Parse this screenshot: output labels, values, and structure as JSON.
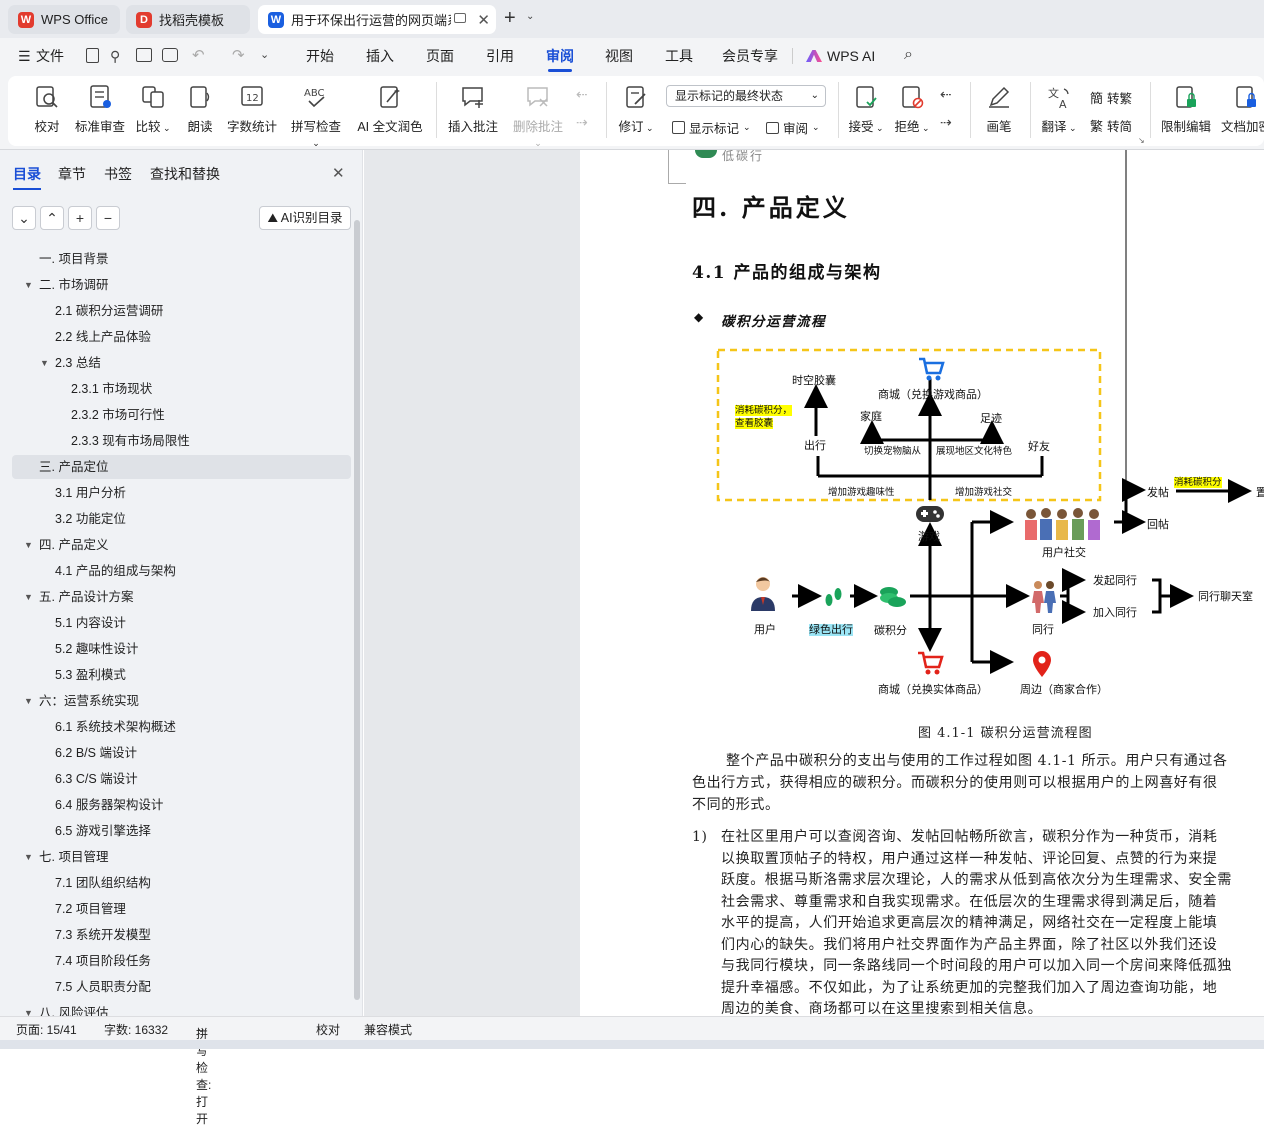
{
  "tabs": [
    {
      "label": "WPS Office",
      "icon_color": "#e23b2e"
    },
    {
      "label": "找稻壳模板",
      "icon_color": "#e23b2e"
    },
    {
      "label": "用于环保出行运营的网页端系",
      "icon_color": "#1a5fe0"
    }
  ],
  "menu": {
    "file": "文件",
    "items": [
      "开始",
      "插入",
      "页面",
      "引用",
      "审阅",
      "视图",
      "工具",
      "会员专享"
    ],
    "wps_ai": "WPS AI",
    "selected": "审阅"
  },
  "ribbon": {
    "buttons": [
      "校对",
      "标准审查",
      "比较",
      "朗读",
      "字数统计",
      "拼写检查",
      "AI 全文润色",
      "插入批注",
      "删除批注",
      "修订",
      "画笔",
      "限制编辑",
      "文档加密"
    ],
    "display_state": "显示标记的最终状态",
    "show_markup": "显示标记",
    "review": "审阅",
    "accept": "接受",
    "reject": "拒绝",
    "translate": "翻译",
    "to_traditional": "转繁",
    "to_simplified": "转简"
  },
  "sidebar": {
    "tabs": [
      "目录",
      "章节",
      "书签",
      "查找和替换"
    ],
    "ai_button": "AI识别目录",
    "toc": [
      "一. 项目背景",
      "二. 市场调研",
      "2.1 碳积分运营调研",
      "2.2 线上产品体验",
      "2.3 总结",
      "2.3.1 市场现状",
      "2.3.2 市场可行性",
      "2.3.3 现有市场局限性",
      "三. 产品定位",
      "3.1 用户分析",
      "3.2 功能定位",
      "四. 产品定义",
      "4.1 产品的组成与架构",
      "五. 产品设计方案",
      "5.1 内容设计",
      "5.2 趣味性设计",
      "5.3 盈利模式",
      "六：运营系统实现",
      "6.1 系统技术架构概述",
      "6.2 B/S 端设计",
      "6.3 C/S 端设计",
      "6.4 服务器架构设计",
      "6.5 游戏引擎选择",
      "七. 项目管理",
      "7.1 团队组织结构",
      "7.2 项目管理",
      "7.3 系统开发模型",
      "7.4 项目阶段任务",
      "7.5 人员职责分配",
      "八. 风险评估"
    ]
  },
  "document": {
    "header_text": "低碳行",
    "chapter_title": "四. 产品定义",
    "section_title": "4.1 产品的组成与架构",
    "bullet_title": "碳积分运营流程",
    "figure_caption": "图 4.1-1 碳积分运营流程图",
    "flow_labels": {
      "time_capsule": "时空胶囊",
      "mall_game": "商城（兑换游戏商品）",
      "consume_view": "消耗碳积分，\n查看胶囊",
      "family": "家庭",
      "footprint": "足迹",
      "travel": "出行",
      "friend": "好友",
      "switch_pet": "切换宠物脑从",
      "show_culture": "展现地区文化特色",
      "fun": "增加游戏趣味性",
      "social": "增加游戏社交",
      "game": "游戏",
      "user_social": "用户社交",
      "post": "发帖",
      "consume": "消耗碳积分",
      "pin": "置顶",
      "reply": "回帖",
      "user": "用户",
      "green_travel": "绿色出行",
      "carbon": "碳积分",
      "together": "同行",
      "start_together": "发起同行",
      "join_together": "加入同行",
      "chat": "同行聊天室",
      "mall_real": "商城（兑换实体商品）",
      "nearby": "周边（商家合作）"
    },
    "para1": [
      "整个产品中碳积分的支出与使用的工作过程如图 4.1-1 所示。用户只有通过各",
      "色出行方式，获得相应的碳积分。而碳积分的使用则可以根据用户的上网喜好有很",
      "不同的形式。"
    ],
    "list_num": "1)",
    "para2": [
      "在社区里用户可以查阅咨询、发帖回帖畅所欲言，碳积分作为一种货币，消耗",
      "以换取置顶帖子的特权，用户通过这样一种发帖、评论回复、点赞的行为来提",
      "跃度。根据马斯洛需求层次理论，人的需求从低到高依次分为生理需求、安全需",
      "社会需求、尊重需求和自我实现需求。在低层次的生理需求得到满足后，随着",
      "水平的提高，人们开始追求更高层次的精神满足，网络社交在一定程度上能填",
      "们内心的缺失。我们将用户社交界面作为产品主界面，除了社区以外我们还设",
      "与我同行模块，同一条路线同一个时间段的用户可以加入同一个房间来降低孤独",
      "提升幸福感。不仅如此，为了让系统更加的完整我们加入了周边查询功能，地",
      "周边的美食、商场都可以在这里搜索到相关信息。"
    ]
  },
  "status": {
    "page": "页面: 15/41",
    "words": "字数: 16332",
    "spell": "拼写检查: 打开",
    "proof": "校对",
    "compat": "兼容模式"
  }
}
